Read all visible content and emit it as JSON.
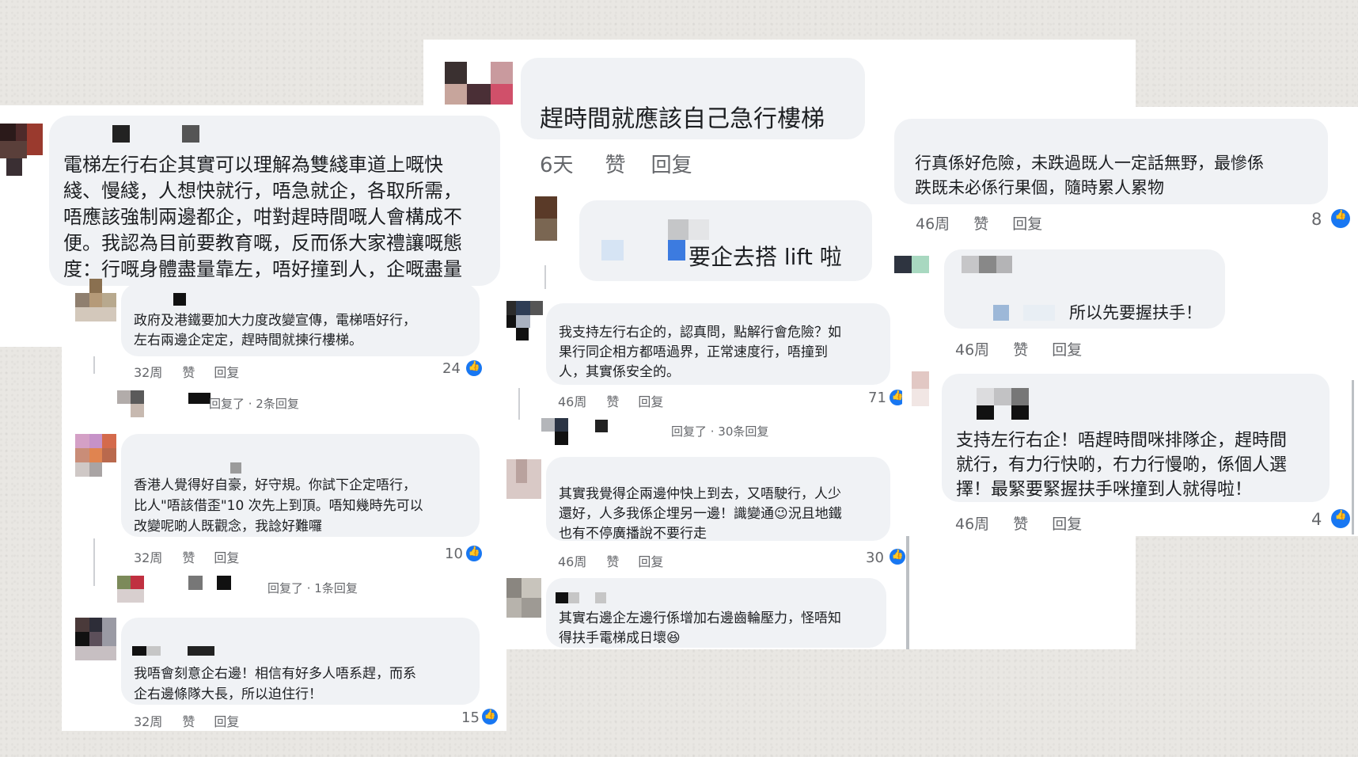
{
  "colors": {
    "accent": "#1877f2",
    "bubble": "#f0f2f5",
    "meta": "#65676b",
    "text": "#1c1e21"
  },
  "left_panel": {
    "main_comment": {
      "text_lines": [
        "電梯左行右企其實可以理解為雙綫車道上嘅快",
        "綫、慢綫，人想快就行，唔急就企，各取所需，",
        "唔應該強制兩邊都企，咁對趕時間嘅人會構成不",
        "便。我認為目前要教育嘅，反而係大家禮讓嘅態",
        "度：行嘅身體盡量靠左，唔好撞到人，企嘅盡量"
      ]
    },
    "replies": [
      {
        "text_lines": [
          "政府及港鐵要加大力度改變宣傳，電梯唔好行，",
          "左右兩邊企定定，趕時間就揀行樓梯。"
        ],
        "time": "32周",
        "like": "赞",
        "reply": "回复",
        "count": "24",
        "sub_reply": "回复了 · 2条回复"
      },
      {
        "text_lines": [
          "香港人覺得好自豪，好守規。你試下企定唔行，",
          "比人\"唔該借歪\"10 次先上到頂。唔知幾時先可以",
          "改變呢啲人既觀念，我諗好難囉"
        ],
        "time": "32周",
        "like": "赞",
        "reply": "回复",
        "count": "10",
        "sub_reply": "回复了 · 1条回复"
      },
      {
        "text_lines": [
          "我唔會刻意企右邊！相信有好多人唔系趕，而系",
          "企右邊條隊大長，所以迫住行！"
        ],
        "time": "32周",
        "like": "赞",
        "reply": "回复",
        "count": "15"
      }
    ]
  },
  "middle_panel": {
    "top_comment": {
      "text": "趕時間就應該自己急行樓梯",
      "time": "6天",
      "like": "赞",
      "reply": "回复"
    },
    "second_comment": {
      "text": "要企去搭 lift 啦"
    },
    "comments": [
      {
        "text_lines": [
          "我支持左行右企的，認真問，點解行會危險？如",
          "果行同企相方都唔過界，正常速度行，唔撞到",
          "人，其實係安全的。"
        ],
        "time": "46周",
        "like": "赞",
        "reply": "回复",
        "count": "71",
        "sub_reply": "回复了 · 30条回复"
      },
      {
        "text_lines": [
          "其實我覺得企兩邊仲快上到去，又唔駛行，人少",
          "還好，人多我係企埋另一邊！識變通😉況且地鐵",
          "也有不停廣播說不要行走"
        ],
        "time": "46周",
        "like": "赞",
        "reply": "回复",
        "count": "30"
      },
      {
        "text_lines": [
          "其實右邊企左邊行係增加右邊齒輪壓力，怪唔知",
          "得扶手電梯成日壞😆"
        ]
      }
    ]
  },
  "right_panel": {
    "comments": [
      {
        "text_lines": [
          "行真係好危險，未跌過既人一定話無野，最慘係",
          "跌既未必係行果個，隨時累人累物"
        ],
        "time": "46周",
        "like": "赞",
        "reply": "回复",
        "count": "8"
      },
      {
        "text_lines": [
          "所以先要握扶手！"
        ],
        "time": "46周",
        "like": "赞",
        "reply": "回复"
      },
      {
        "text_lines": [
          "支持左行右企！唔趕時間咪排隊企，趕時間",
          "就行，有力行快啲，冇力行慢啲，係個人選",
          "擇！最緊要緊握扶手咪撞到人就得啦！"
        ],
        "time": "46周",
        "like": "赞",
        "reply": "回复",
        "count": "4"
      }
    ]
  },
  "icons": {
    "like_reaction": "like-reaction-icon",
    "avatar": "avatar-icon"
  }
}
